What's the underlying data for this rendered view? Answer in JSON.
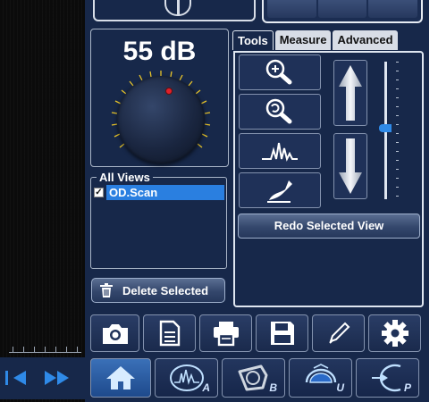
{
  "gain": {
    "value": "55 dB"
  },
  "views": {
    "legend": "All Views",
    "items": [
      {
        "label": "OD.Scan",
        "checked": true
      }
    ],
    "delete_label": "Delete Selected"
  },
  "tabs": [
    {
      "label": "Tools",
      "active": true
    },
    {
      "label": "Measure",
      "active": false
    },
    {
      "label": "Advanced",
      "active": false
    }
  ],
  "tools": {
    "buttons": [
      "zoom-in-icon",
      "zoom-reset-icon",
      "waveform-icon",
      "annotate-pen-icon"
    ],
    "arrows": [
      "arrow-up-icon",
      "arrow-down-icon"
    ],
    "redo_label": "Redo Selected View"
  },
  "toolbar_icons": [
    "camera-icon",
    "document-icon",
    "printer-icon",
    "save-icon",
    "pencil-icon",
    "gear-icon"
  ],
  "mode_buttons": [
    {
      "icon": "home-icon",
      "letter": ""
    },
    {
      "icon": "a-scan-icon",
      "letter": "A"
    },
    {
      "icon": "b-scan-icon",
      "letter": "B"
    },
    {
      "icon": "ubm-scan-icon",
      "letter": "U"
    },
    {
      "icon": "pachymetry-icon",
      "letter": "P"
    }
  ],
  "colors": {
    "panel": "#17284a",
    "accent": "#2a7fe0",
    "knob_indicator": "#e0202a"
  }
}
